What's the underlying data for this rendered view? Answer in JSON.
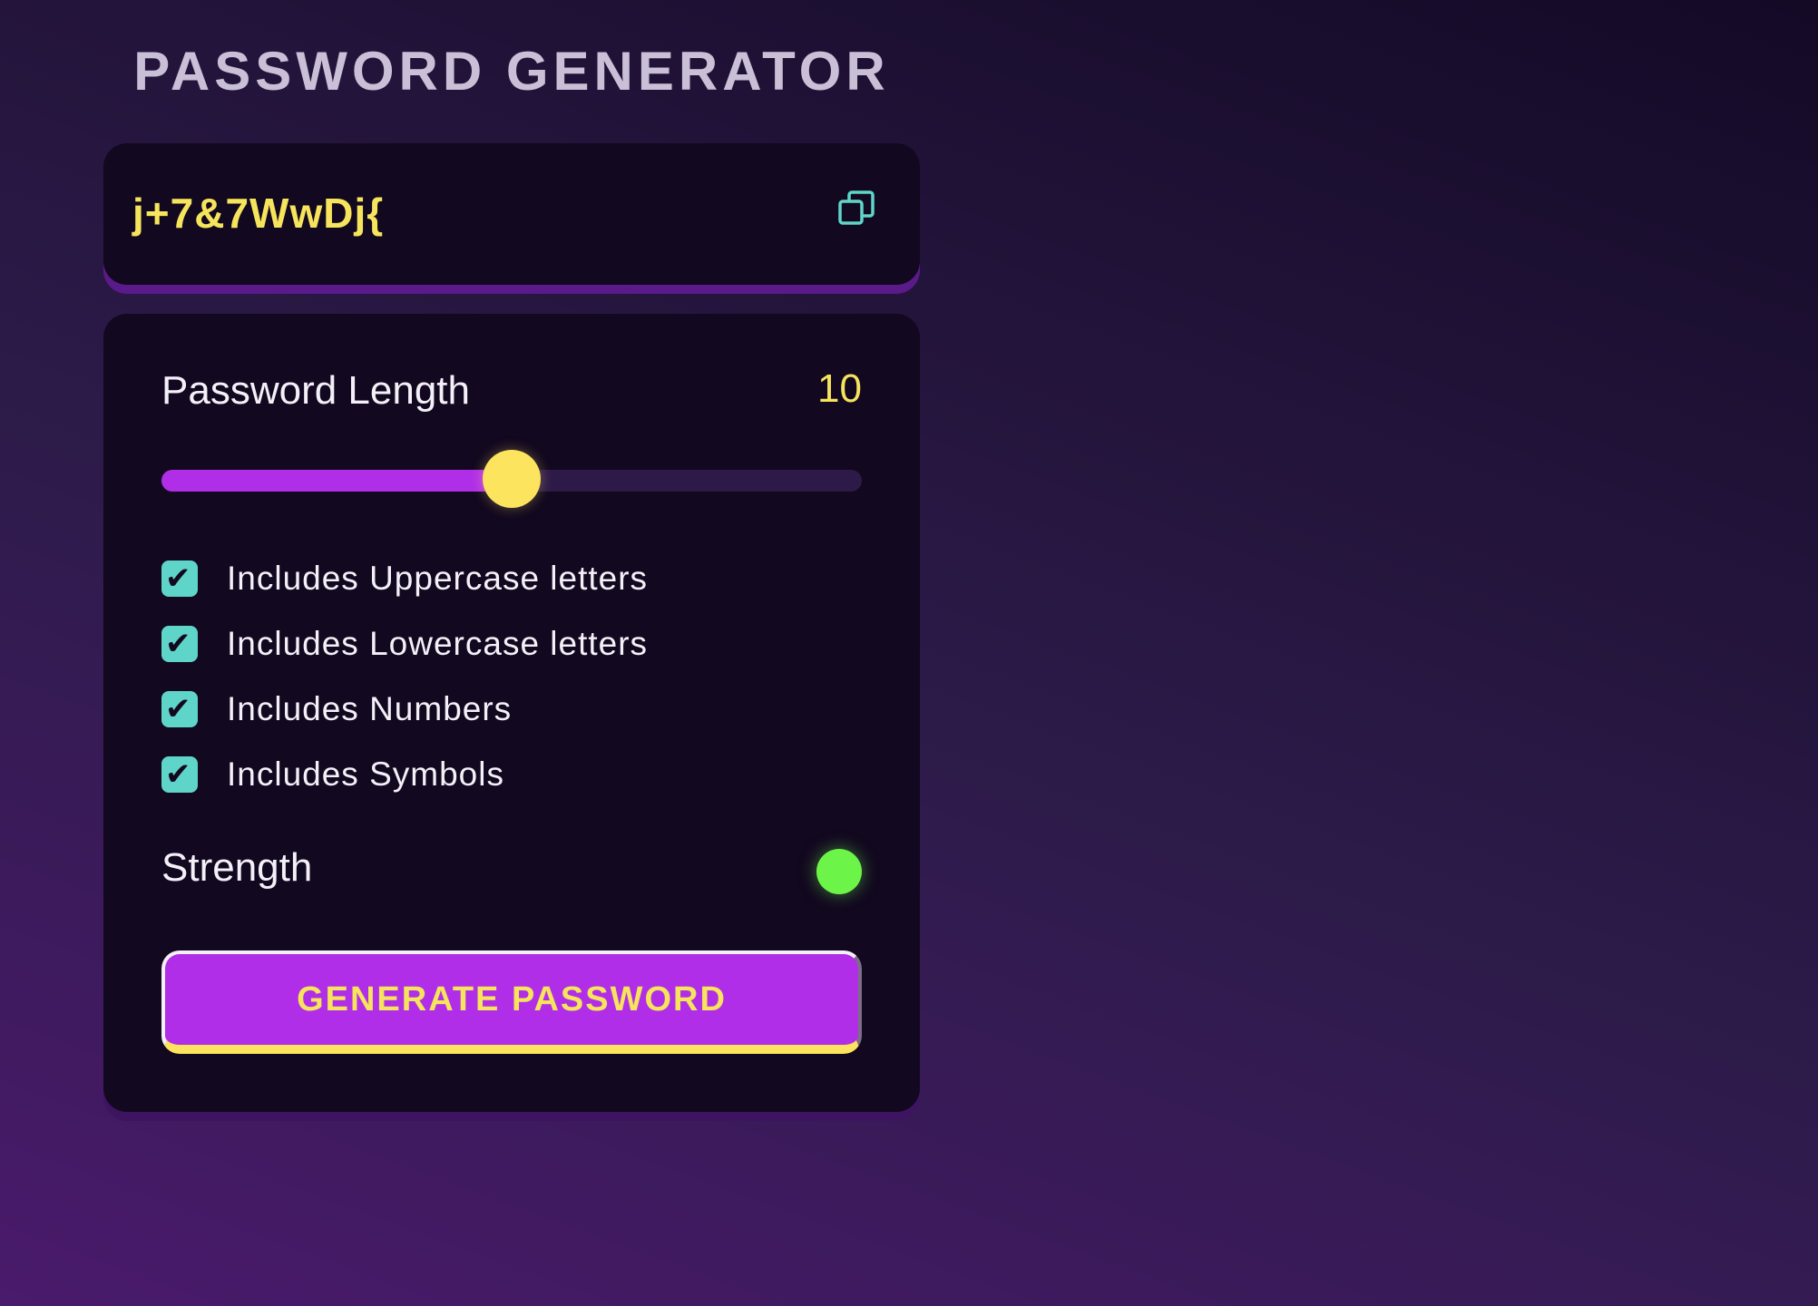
{
  "header": {
    "title": "PASSWORD GENERATOR"
  },
  "output": {
    "password": "j+7&7WwDj{",
    "copy_icon": "copy-icon"
  },
  "length": {
    "label": "Password Length",
    "value": "10",
    "min": 0,
    "max": 20,
    "current": 10
  },
  "options": [
    {
      "label": "Includes Uppercase letters",
      "checked": true
    },
    {
      "label": "Includes Lowercase letters",
      "checked": true
    },
    {
      "label": "Includes Numbers",
      "checked": true
    },
    {
      "label": "Includes Symbols",
      "checked": true
    }
  ],
  "strength": {
    "label": "Strength",
    "indicator_color": "#6cf548"
  },
  "actions": {
    "generate_label": "GENERATE PASSWORD"
  },
  "colors": {
    "accent": "#b12ee8",
    "highlight": "#fde45e",
    "checkbox": "#5fd5c9",
    "card": "#12081f"
  }
}
